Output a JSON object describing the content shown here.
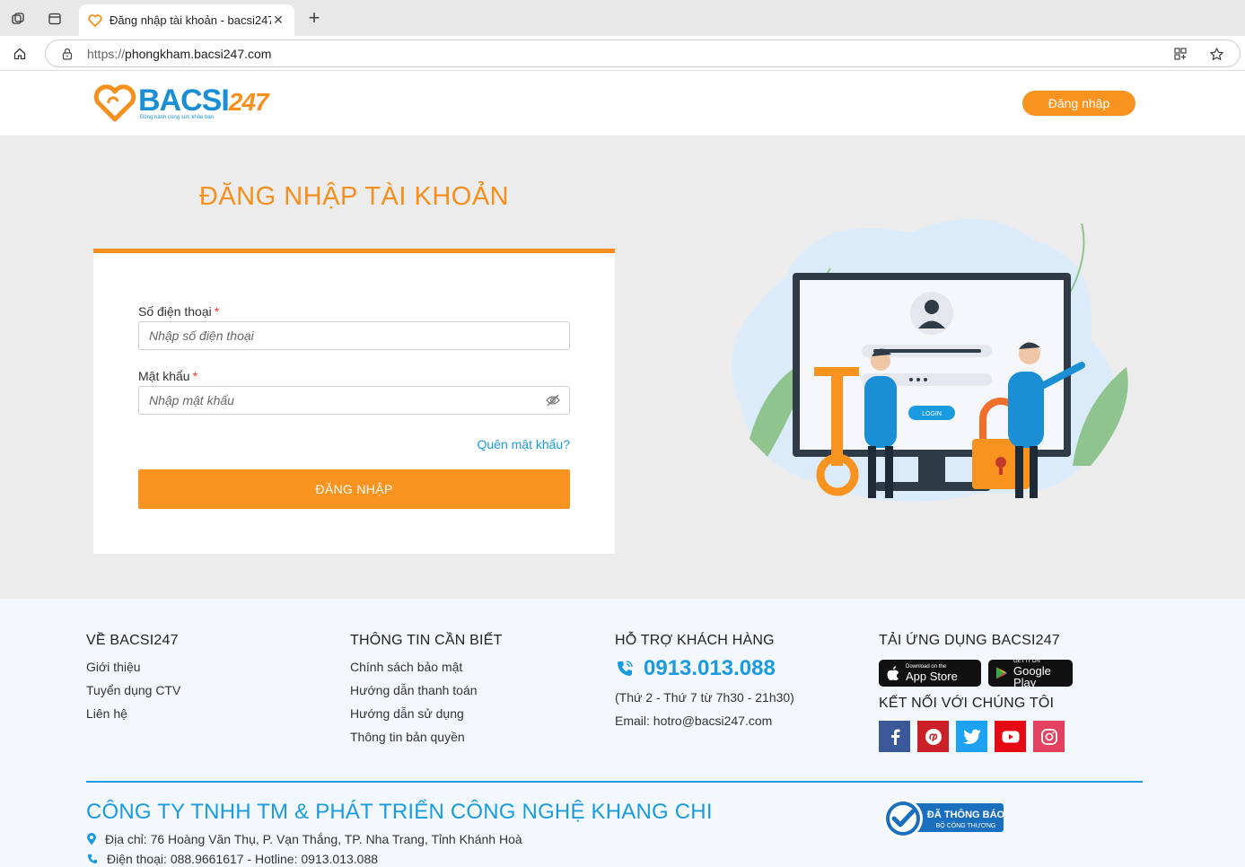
{
  "browser": {
    "tab_title": "Đăng nhập tài khoản - bacsi247.c",
    "url_protocol": "https://",
    "url_host": "phongkham.bacsi247.com"
  },
  "header": {
    "logo_main": "BACSI",
    "logo_number": "247",
    "logo_tagline": "Đồng hành cùng sức khỏe bạn",
    "login_button": "Đăng nhập"
  },
  "login": {
    "title": "ĐĂNG NHẬP TÀI KHOẢN",
    "phone_label": "Số điện thoại",
    "phone_placeholder": "Nhập số điện thoại",
    "password_label": "Mật khẩu",
    "password_placeholder": "Nhập mật khẩu",
    "required_mark": "*",
    "forgot": "Quên mật khẩu?",
    "submit": "ĐĂNG NHẬP",
    "illus_button": "LOGIN"
  },
  "footer": {
    "about": {
      "heading": "VỀ BACSI247",
      "links": [
        "Giới thiệu",
        "Tuyển dụng CTV",
        "Liên hệ"
      ]
    },
    "info": {
      "heading": "THÔNG TIN CẦN BIẾT",
      "links": [
        "Chính sách bảo mật",
        "Hướng dẫn thanh toán",
        "Hướng dẫn sử dụng",
        "Thông tin bản quyền"
      ]
    },
    "support": {
      "heading": "HỖ TRỢ KHÁCH HÀNG",
      "hotline": "0913.013.088",
      "hours": "(Thứ 2 - Thứ 7 từ 7h30 - 21h30)",
      "email": "Email: hotro@bacsi247.com"
    },
    "app": {
      "heading": "TẢI ỨNG DỤNG BACSI247",
      "appstore_small": "Download on the",
      "appstore_big": "App Store",
      "gplay_small": "GET IT ON",
      "gplay_big": "Google Play",
      "connect_heading": "KẾT NỐI VỚI CHÚNG TÔI"
    },
    "company": "CÔNG TY TNHH TM & PHÁT TRIỂN CÔNG NGHỆ KHANG CHI",
    "address": "Địa chỉ: 76 Hoàng Văn Thụ, P. Vạn Thắng, TP. Nha Trang, Tỉnh Khánh Hoà",
    "phone": "Điện thoại: 088.9661617 - Hotline: 0913.013.088",
    "badge_main": "ĐÃ THÔNG BÁO",
    "badge_sub": "BỘ CÔNG THƯƠNG"
  },
  "colors": {
    "orange": "#f7931e",
    "blue": "#1a9be0",
    "facebook": "#3b5998",
    "pinterest": "#cb2027",
    "twitter": "#1da1f2",
    "youtube": "#e50914",
    "instagram": "#e4405f"
  }
}
